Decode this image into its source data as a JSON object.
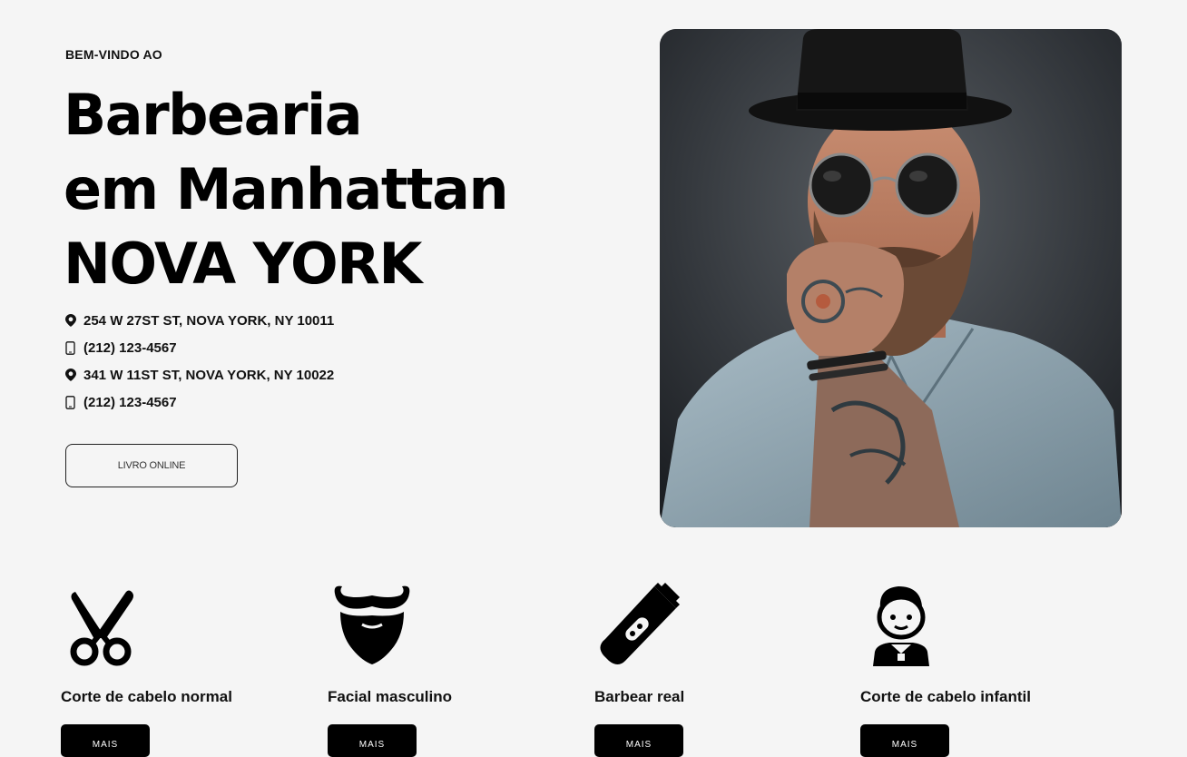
{
  "hero": {
    "eyebrow": "BEM-VINDO AO",
    "headline_lines": [
      "Barbearia",
      "em Manhattan",
      "NOVA YORK"
    ],
    "contacts": [
      {
        "icon": "map-pin-icon",
        "text": "254 W 27ST ST, NOVA YORK, NY 10011"
      },
      {
        "icon": "phone-icon",
        "text": "(212) 123-4567"
      },
      {
        "icon": "map-pin-icon",
        "text": "341 W 11ST ST, NOVA YORK, NY 10022"
      },
      {
        "icon": "phone-icon",
        "text": "(212) 123-4567"
      }
    ],
    "book_button": "LIVRO ONLINE",
    "photo": "bearded-man-top-hat-photo"
  },
  "services": [
    {
      "icon": "scissors-icon",
      "title": "Corte de cabelo normal",
      "button": "MAIS"
    },
    {
      "icon": "mustache-beard-icon",
      "title": "Facial masculino",
      "button": "MAIS"
    },
    {
      "icon": "hair-clipper-icon",
      "title": "Barbear real",
      "button": "MAIS"
    },
    {
      "icon": "child-face-icon",
      "title": "Corte de cabelo infantil",
      "button": "MAIS"
    }
  ],
  "colors": {
    "background": "#f5f5f5",
    "text": "#111111",
    "button_dark": "#000000"
  }
}
